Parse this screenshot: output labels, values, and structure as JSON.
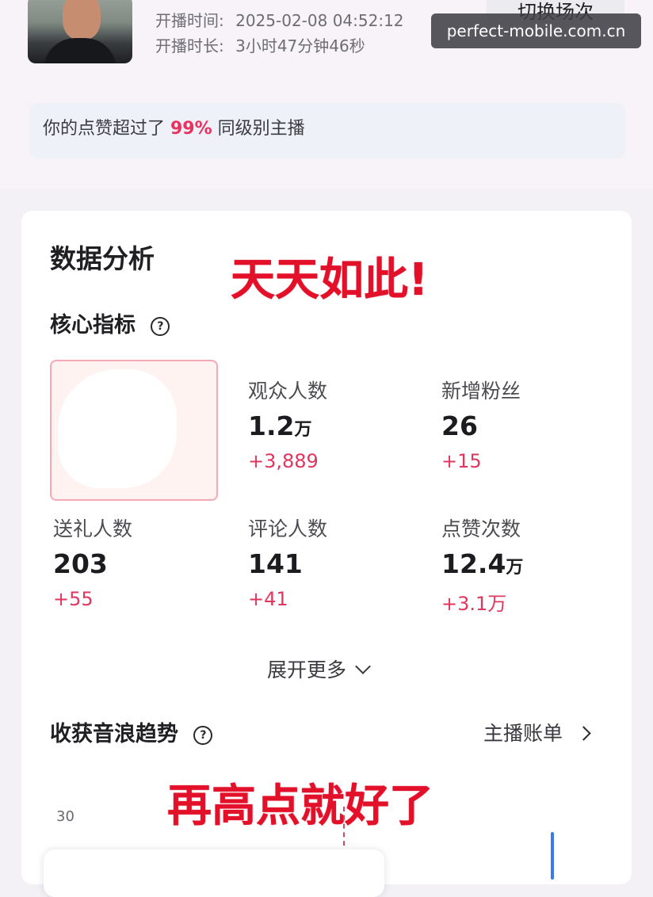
{
  "header": {
    "start_time_label": "开播时间:",
    "start_time_value": "2025-02-08 04:52:12",
    "duration_label": "开播时长:",
    "duration_value": "3小时47分钟46秒",
    "switch_button": "切换场次",
    "watermark": "perfect-mobile.com.cn"
  },
  "likes_banner": {
    "prefix": "你的点赞超过了 ",
    "percent": "99%",
    "suffix": " 同级别主播"
  },
  "analysis": {
    "title": "数据分析",
    "note_top": "天天如此!",
    "core_title": "核心指标",
    "help_glyph": "?",
    "metrics": [
      {
        "label": "观众人数",
        "value": "1.2",
        "unit": "万",
        "delta": "+3,889"
      },
      {
        "label": "新增粉丝",
        "value": "26",
        "unit": "",
        "delta": "+15"
      },
      {
        "label": "送礼人数",
        "value": "203",
        "unit": "",
        "delta": "+55"
      },
      {
        "label": "评论人数",
        "value": "141",
        "unit": "",
        "delta": "+41"
      },
      {
        "label": "点赞次数",
        "value": "12.4",
        "unit": "万",
        "delta": "+3.1万"
      }
    ],
    "expand_label": "展开更多",
    "trend_title": "收获音浪趋势",
    "bill_label": "主播账单",
    "note_bottom": "再高点就好了",
    "y_tick": "30"
  },
  "colors": {
    "accent_pink": "#e0375f",
    "annotation_red": "#e3102a",
    "bar_blue": "#3b7be8"
  }
}
